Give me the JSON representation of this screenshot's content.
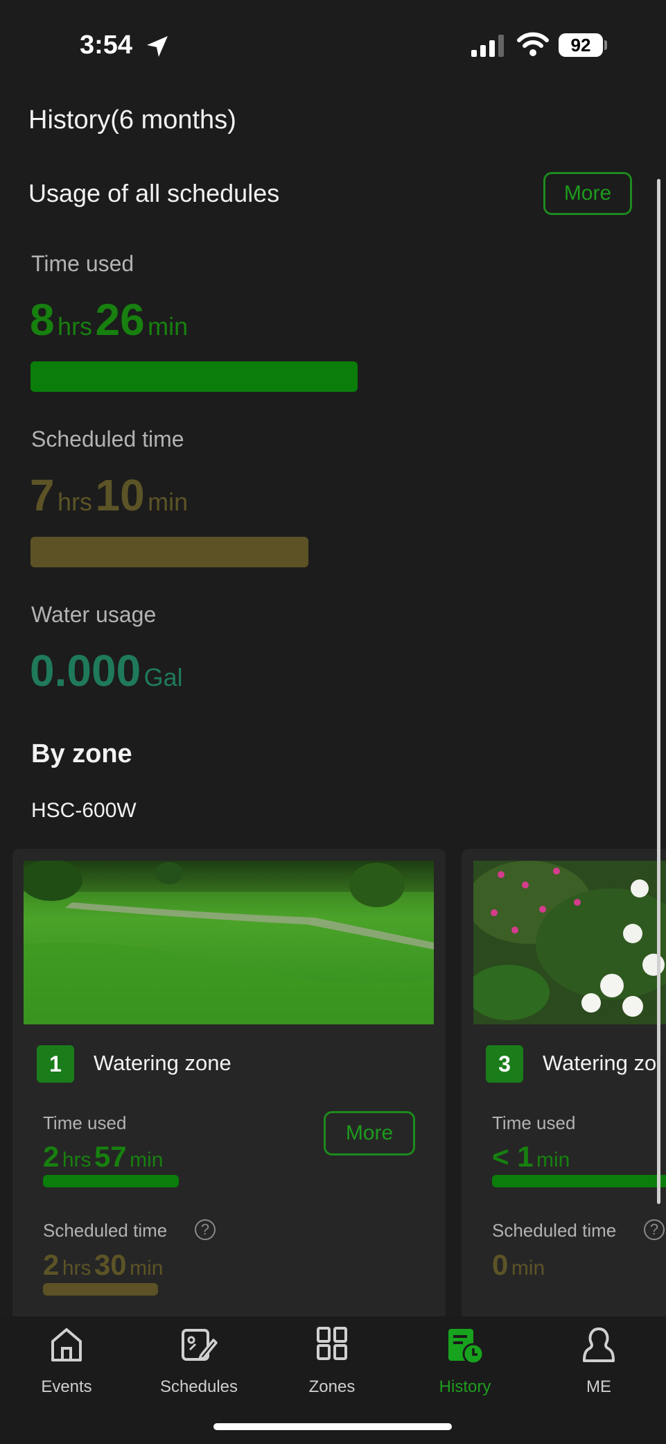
{
  "status_bar": {
    "time": "3:54",
    "battery": "92"
  },
  "page_title": "History(6 months)",
  "summary": {
    "title": "Usage of all schedules",
    "more_label": "More",
    "time_used": {
      "label": "Time used",
      "hrs": "8",
      "hrs_unit": "hrs",
      "min": "26",
      "min_unit": "min"
    },
    "scheduled_time": {
      "label": "Scheduled time",
      "hrs": "7",
      "hrs_unit": "hrs",
      "min": "10",
      "min_unit": "min"
    },
    "water_usage": {
      "label": "Water usage",
      "value": "0.000",
      "unit": "Gal"
    }
  },
  "by_zone": {
    "title": "By zone",
    "device": "HSC-600W",
    "zones": [
      {
        "number": "1",
        "name": "Watering zone",
        "more_label": "More",
        "time_used_label": "Time used",
        "used_hrs": "2",
        "used_hrs_unit": "hrs",
        "used_min": "57",
        "used_min_unit": "min",
        "scheduled_label": "Scheduled time",
        "help": "?",
        "sched_hrs": "2",
        "sched_hrs_unit": "hrs",
        "sched_min": "30",
        "sched_min_unit": "min"
      },
      {
        "number": "3",
        "name": "Watering zo",
        "time_used_label": "Time used",
        "used_prefix": "< 1",
        "used_min_unit": "min",
        "scheduled_label": "Scheduled time",
        "sched_min": "0",
        "sched_min_unit": "min"
      }
    ]
  },
  "tabs": [
    {
      "label": "Events",
      "icon": "home-icon"
    },
    {
      "label": "Schedules",
      "icon": "schedule-edit-icon"
    },
    {
      "label": "Zones",
      "icon": "grid-icon"
    },
    {
      "label": "History",
      "icon": "history-icon",
      "active": true
    },
    {
      "label": "ME",
      "icon": "person-icon"
    }
  ],
  "colors": {
    "accent_green": "#17800f",
    "olive": "#5c5426",
    "teal": "#1f7a5a",
    "background": "#1c1c1c"
  }
}
